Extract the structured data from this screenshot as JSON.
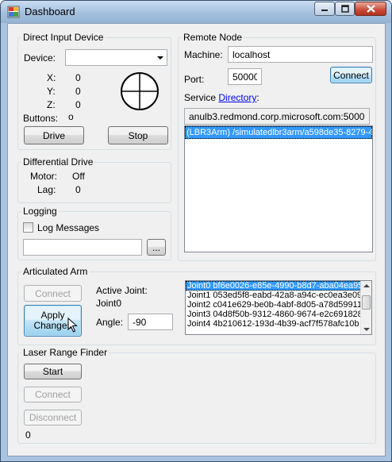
{
  "window": {
    "title": "Dashboard"
  },
  "direct_input": {
    "group_label": "Direct Input Device",
    "device_label": "Device:",
    "device_value": "",
    "x_label": "X:",
    "x_value": "0",
    "y_label": "Y:",
    "y_value": "0",
    "z_label": "Z:",
    "z_value": "0",
    "buttons_label": "Buttons:",
    "buttons_value": "o",
    "drive_label": "Drive",
    "stop_label": "Stop"
  },
  "remote_node": {
    "group_label": "Remote Node",
    "machine_label": "Machine:",
    "machine_value": "localhost",
    "port_label": "Port:",
    "port_value": "50000",
    "connect_label": "Connect",
    "service_prefix": "Service ",
    "service_link": "Directory",
    "service_suffix": ":",
    "directory_value": "anulb3.redmond.corp.microsoft.com:50000",
    "services": [
      "(LBR3Arm) /simulatedlbr3arm/a598de35-8279-4c"
    ]
  },
  "differential_drive": {
    "group_label": "Differential Drive",
    "motor_label": "Motor:",
    "motor_value": "Off",
    "lag_label": "Lag:",
    "lag_value": "0"
  },
  "logging": {
    "group_label": "Logging",
    "log_messages_label": "Log Messages",
    "log_file_value": "",
    "browse_label": "..."
  },
  "articulated_arm": {
    "group_label": "Articulated Arm",
    "connect_label": "Connect",
    "apply_changes_label": "Apply Changes",
    "active_joint_label": "Active Joint:",
    "active_joint_value": "Joint0",
    "angle_label": "Angle:",
    "angle_value": "-90",
    "joints": [
      "Joint0 bf6e0026-e85e-4990-b8d7-aba04ea95",
      "Joint1 053ed5f8-eabd-42a8-a94c-ec0ea3e09",
      "Joint2 c041e629-be0b-4abf-8d05-a78d59911",
      "Joint3 04d8f50b-9312-4860-9674-e2c691828",
      "Joint4 4b210612-193d-4b39-acf7f578afc10b"
    ]
  },
  "laser_range_finder": {
    "group_label": "Laser Range Finder",
    "start_label": "Start",
    "connect_label": "Connect",
    "disconnect_label": "Disconnect",
    "value": "0"
  }
}
